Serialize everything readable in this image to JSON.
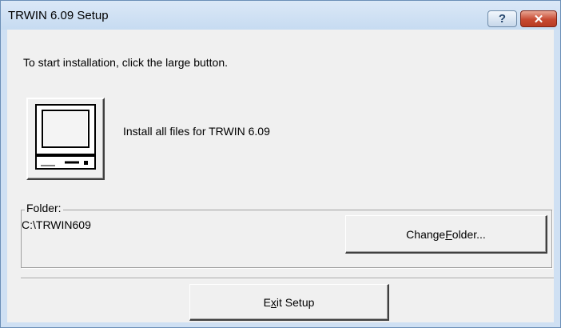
{
  "window": {
    "title": "TRWIN 6.09 Setup",
    "help_glyph": "?",
    "close_glyph": "✕"
  },
  "instruction": "To start installation, click the large button.",
  "install": {
    "icon": "computer-icon",
    "label": "Install all files for TRWIN 6.09"
  },
  "folder": {
    "legend": "Folder:",
    "path": "C:\\TRWIN609",
    "change_button": {
      "before": "Change ",
      "mnemonic": "F",
      "after": "older..."
    }
  },
  "exit_button": {
    "before": "E",
    "mnemonic": "x",
    "after": "it Setup"
  }
}
